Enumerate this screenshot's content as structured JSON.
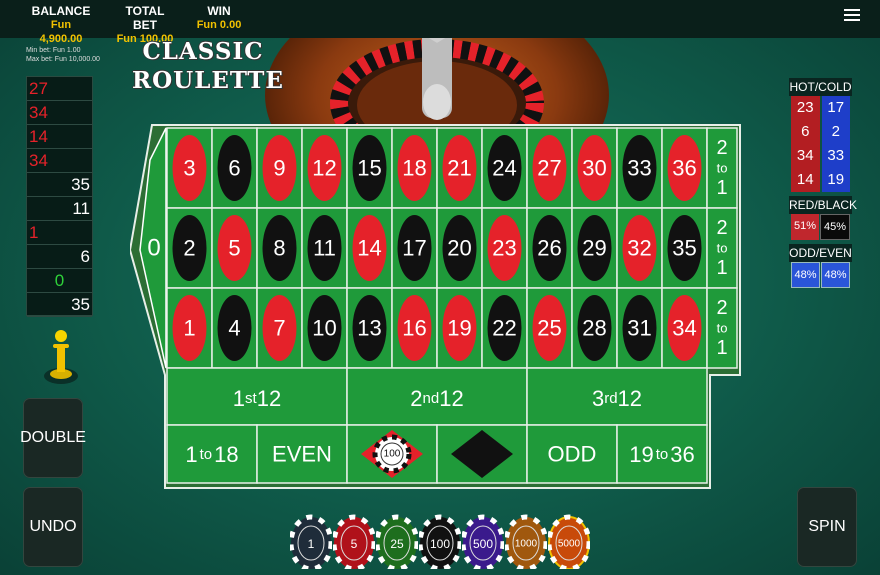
{
  "topbar": {
    "balance_label": "BALANCE",
    "balance_value": "Fun 4,900.00",
    "total_bet_label": "TOTAL BET",
    "total_bet_value": "Fun 100.00",
    "win_label": "WIN",
    "win_value": "Fun 0.00"
  },
  "limits": {
    "min": "Min bet: Fun 1.00",
    "max": "Max bet: Fun 10,000.00"
  },
  "logo": {
    "line1": "CLASSIC",
    "line2": "ROULETTE"
  },
  "history": [
    {
      "n": "27",
      "color": "red"
    },
    {
      "n": "34",
      "color": "red"
    },
    {
      "n": "14",
      "color": "red"
    },
    {
      "n": "34",
      "color": "red"
    },
    {
      "n": "35",
      "color": "black"
    },
    {
      "n": "11",
      "color": "black"
    },
    {
      "n": "1",
      "color": "red"
    },
    {
      "n": "6",
      "color": "black"
    },
    {
      "n": "0",
      "color": "green"
    },
    {
      "n": "35",
      "color": "black"
    }
  ],
  "buttons": {
    "double": "DOUBLE",
    "undo": "UNDO",
    "spin": "SPIN"
  },
  "stats": {
    "hotcold_label": "HOT/COLD",
    "hot": [
      "23",
      "6",
      "34",
      "14"
    ],
    "cold": [
      "17",
      "2",
      "33",
      "19"
    ],
    "redblack_label": "RED/BLACK",
    "red_pct": "51%",
    "black_pct": "45%",
    "oddeven_label": "ODD/EVEN",
    "odd_pct": "48%",
    "even_pct": "48%"
  },
  "table": {
    "zero": "0",
    "rows": [
      [
        {
          "n": "3",
          "c": "red"
        },
        {
          "n": "6",
          "c": "black"
        },
        {
          "n": "9",
          "c": "red"
        },
        {
          "n": "12",
          "c": "red"
        },
        {
          "n": "15",
          "c": "black"
        },
        {
          "n": "18",
          "c": "red"
        },
        {
          "n": "21",
          "c": "red"
        },
        {
          "n": "24",
          "c": "black"
        },
        {
          "n": "27",
          "c": "red"
        },
        {
          "n": "30",
          "c": "red"
        },
        {
          "n": "33",
          "c": "black"
        },
        {
          "n": "36",
          "c": "red"
        }
      ],
      [
        {
          "n": "2",
          "c": "black"
        },
        {
          "n": "5",
          "c": "red"
        },
        {
          "n": "8",
          "c": "black"
        },
        {
          "n": "11",
          "c": "black"
        },
        {
          "n": "14",
          "c": "red"
        },
        {
          "n": "17",
          "c": "black"
        },
        {
          "n": "20",
          "c": "black"
        },
        {
          "n": "23",
          "c": "red"
        },
        {
          "n": "26",
          "c": "black"
        },
        {
          "n": "29",
          "c": "black"
        },
        {
          "n": "32",
          "c": "red"
        },
        {
          "n": "35",
          "c": "black"
        }
      ],
      [
        {
          "n": "1",
          "c": "red"
        },
        {
          "n": "4",
          "c": "black"
        },
        {
          "n": "7",
          "c": "red"
        },
        {
          "n": "10",
          "c": "black"
        },
        {
          "n": "13",
          "c": "black"
        },
        {
          "n": "16",
          "c": "red"
        },
        {
          "n": "19",
          "c": "red"
        },
        {
          "n": "22",
          "c": "black"
        },
        {
          "n": "25",
          "c": "red"
        },
        {
          "n": "28",
          "c": "black"
        },
        {
          "n": "31",
          "c": "black"
        },
        {
          "n": "34",
          "c": "red"
        }
      ]
    ],
    "column_bets": [
      "2 to 1",
      "2 to 1",
      "2 to 1"
    ],
    "dozens": [
      {
        "pre": "1",
        "suf": "st",
        "num": "12"
      },
      {
        "pre": "2",
        "suf": "nd",
        "num": "12"
      },
      {
        "pre": "3",
        "suf": "rd",
        "num": "12"
      }
    ],
    "outside": {
      "low_a": "1",
      "low_to": "to",
      "low_b": "18",
      "even": "EVEN",
      "odd": "ODD",
      "high_a": "19",
      "high_to": "to",
      "high_b": "36"
    },
    "placed_chip": "100"
  },
  "chips": [
    "1",
    "5",
    "25",
    "100",
    "500",
    "1000",
    "5000"
  ],
  "colors": {
    "felt": "#1f9a3a",
    "red": "#e5222a",
    "black": "#111111",
    "accent": "#f2c200"
  }
}
